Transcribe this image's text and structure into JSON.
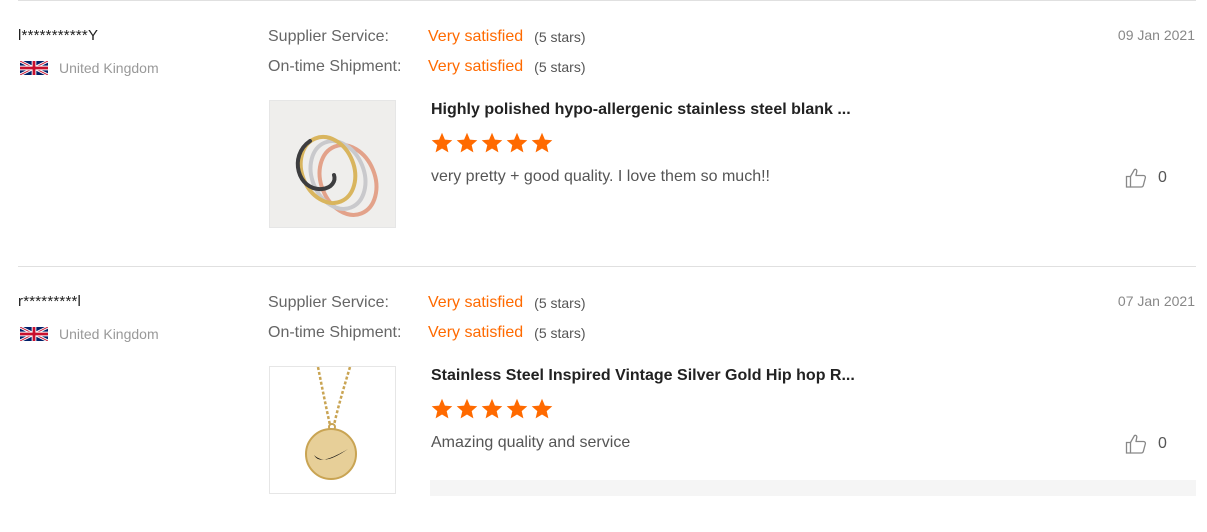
{
  "labels": {
    "supplier_service": "Supplier Service:",
    "ontime_shipment": "On-time Shipment:"
  },
  "colors": {
    "accent": "#ff6a00",
    "divider": "#e0e0e0"
  },
  "reviews": [
    {
      "user": "l***********Y",
      "country": "United Kingdom",
      "flag_icon": "uk-flag-icon",
      "supplier_service": {
        "value": "Very satisfied",
        "stars": "(5 stars)"
      },
      "ontime_shipment": {
        "value": "Very satisfied",
        "stars": "(5 stars)"
      },
      "date": "09 Jan 2021",
      "product_title": "Highly polished hypo-allergenic stainless steel blank ...",
      "product_rating": 5,
      "text": "very pretty + good quality. I love them so much!!",
      "likes": "0",
      "like_icon": "thumbs-up-icon"
    },
    {
      "user": "r*********l",
      "country": "United Kingdom",
      "flag_icon": "uk-flag-icon",
      "supplier_service": {
        "value": "Very satisfied",
        "stars": "(5 stars)"
      },
      "ontime_shipment": {
        "value": "Very satisfied",
        "stars": "(5 stars)"
      },
      "date": "07 Jan 2021",
      "product_title": "Stainless Steel Inspired Vintage Silver Gold Hip hop R...",
      "product_rating": 5,
      "text": "Amazing quality and service",
      "likes": "0",
      "like_icon": "thumbs-up-icon"
    }
  ]
}
